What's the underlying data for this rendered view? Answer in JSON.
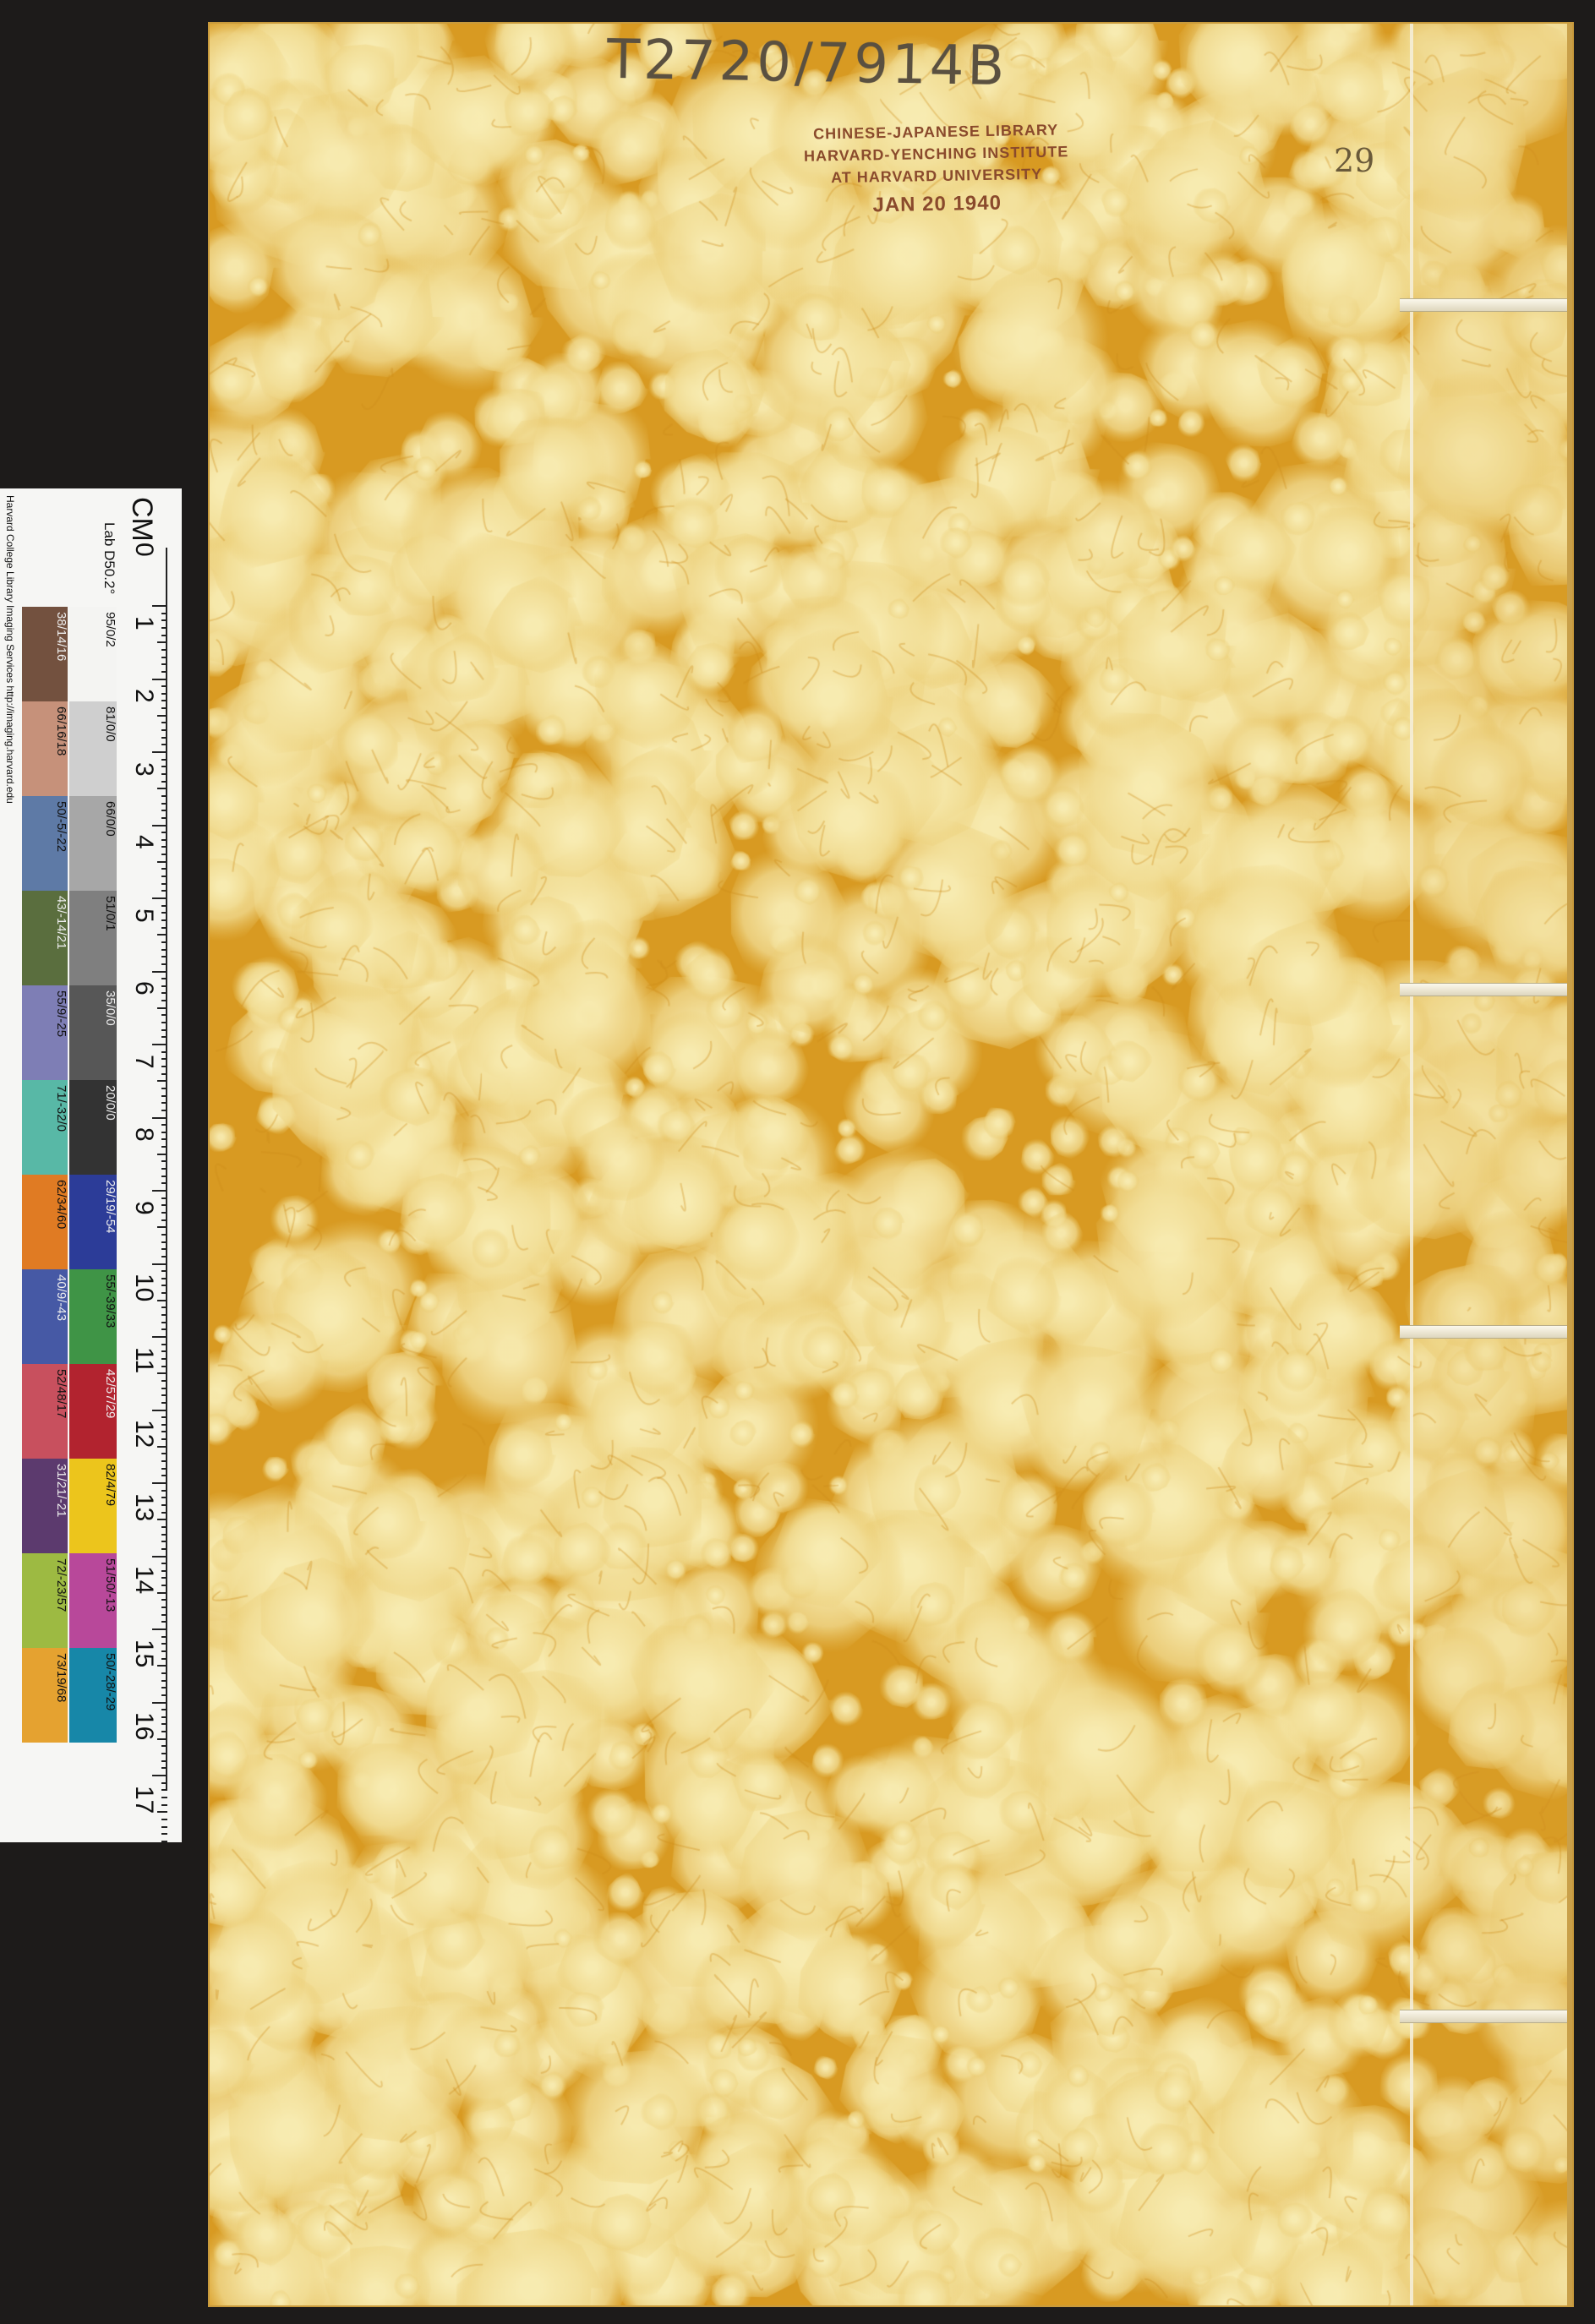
{
  "book": {
    "call_number": "T2720/7914B",
    "stamp": {
      "lines": [
        "CHINESE-JAPANESE LIBRARY",
        "HARVARD-YENCHING INSTITUTE",
        "AT HARVARD UNIVERSITY"
      ],
      "date": "JAN 20 1940"
    },
    "volume_number": "29",
    "colors": {
      "cover_base": "#e9c262",
      "cover_dark": "#d89a22",
      "cover_light": "#f5e6a8",
      "thread": "#f5f1e2"
    }
  },
  "target": {
    "credit": "Harvard College Library Imaging Services http://imaging.harvard.edu",
    "cm_label": "CM",
    "scale_label": "Lab D50.2°",
    "scale_numbers": [
      "0",
      "1",
      "2",
      "3",
      "4",
      "5",
      "6",
      "7",
      "8",
      "9",
      "10",
      "11",
      "12",
      "13",
      "14",
      "15",
      "16",
      "17"
    ],
    "gray_patches": [
      {
        "label": "95/0/2",
        "color": "#f4f4f2"
      },
      {
        "label": "81/0/0",
        "color": "#cfcfcf"
      },
      {
        "label": "66/0/0",
        "color": "#a7a7a7"
      },
      {
        "label": "51/0/1",
        "color": "#7f7f7f"
      },
      {
        "label": "35/0/0",
        "color": "#575757"
      },
      {
        "label": "20/0/0",
        "color": "#333333"
      },
      {
        "label": "29/19/-54",
        "color": "#2c3c98"
      },
      {
        "label": "55/-39/33",
        "color": "#3f9446"
      },
      {
        "label": "42/57/29",
        "color": "#b2232f"
      },
      {
        "label": "82/4/79",
        "color": "#ecc51c"
      },
      {
        "label": "51/50/-13",
        "color": "#b8489a"
      },
      {
        "label": "50/-28/-29",
        "color": "#1787a8"
      }
    ],
    "color_patches": [
      {
        "label": "38/14/16",
        "color": "#73513f"
      },
      {
        "label": "66/16/18",
        "color": "#c6917a"
      },
      {
        "label": "50/-5/-22",
        "color": "#5e7aa6"
      },
      {
        "label": "43/-14/21",
        "color": "#5a6e3e"
      },
      {
        "label": "55/9/-25",
        "color": "#7e7eb5"
      },
      {
        "label": "71/-32/0",
        "color": "#58b8a6"
      },
      {
        "label": "62/34/60",
        "color": "#e07b23"
      },
      {
        "label": "40/9/-43",
        "color": "#4659a5"
      },
      {
        "label": "52/48/17",
        "color": "#c8505e"
      },
      {
        "label": "31/21/-21",
        "color": "#5c3a6e"
      },
      {
        "label": "72/-23/57",
        "color": "#9dba42"
      },
      {
        "label": "73/19/68",
        "color": "#e5a230"
      }
    ]
  }
}
